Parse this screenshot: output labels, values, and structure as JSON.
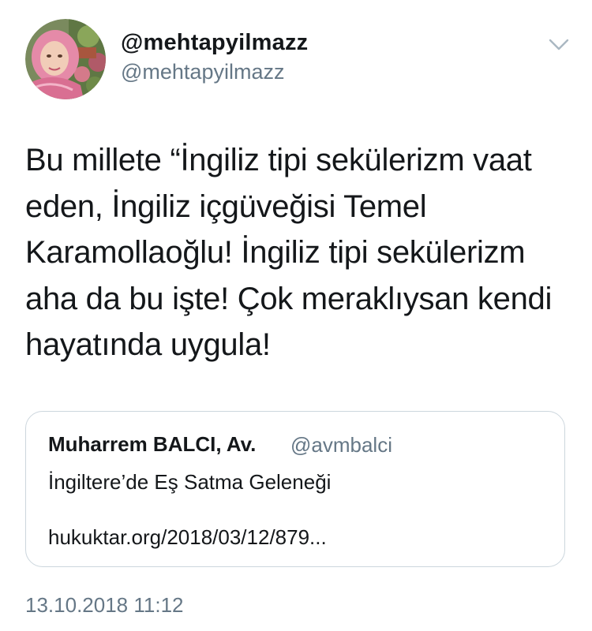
{
  "tweet": {
    "author": {
      "display_name": "@mehtapyilmazz",
      "handle": "@mehtapyilmazz",
      "avatar_icon": "profile-photo"
    },
    "menu_icon": "chevron-down-icon",
    "text_lines": [
      "Bu millete “İngiliz tipi sekülerizm vaat",
      "eden, İngiliz içgüveğisi Temel",
      "Karamollaoğlu! İngiliz tipi sekülerizm",
      "aha da bu işte! Çok meraklıysan kendi",
      "hayatında uygula!"
    ],
    "quoted": {
      "display_name": "Muharrem BALCI, Av.",
      "handle": "@avmbalci",
      "title": "İngiltere’de Eş Satma Geleneği",
      "link": "hukuktar.org/2018/03/12/879..."
    },
    "timestamp": "13.10.2018 11:12"
  },
  "colors": {
    "text_primary": "#14171a",
    "text_secondary": "#657786",
    "border": "#ccd6dd",
    "chevron": "#aab8c2"
  }
}
